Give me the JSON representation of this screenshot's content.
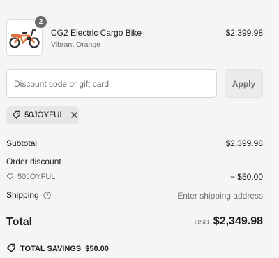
{
  "product": {
    "name": "CG2 Electric Cargo Bike",
    "variant": "Vibrant Orange",
    "price": "$2,399.98",
    "quantity": "2",
    "image_icon": "cargo-bike-image"
  },
  "discount": {
    "placeholder": "Discount code or gift card",
    "value": "",
    "apply_label": "Apply",
    "applied_code": "50JOYFUL"
  },
  "summary": {
    "subtotal_label": "Subtotal",
    "subtotal_value": "$2,399.98",
    "order_discount_label": "Order discount",
    "discount_code": "50JOYFUL",
    "discount_value": "− $50.00",
    "shipping_label": "Shipping",
    "shipping_value": "Enter shipping address",
    "total_label": "Total",
    "currency": "USD",
    "total_value": "$2,349.98",
    "savings_label": "TOTAL SAVINGS",
    "savings_value": "$50.00"
  },
  "colors": {
    "background": "#f5f5f5",
    "bike_orange": "#e0703a",
    "quantity_badge": "#6b6b6b"
  }
}
